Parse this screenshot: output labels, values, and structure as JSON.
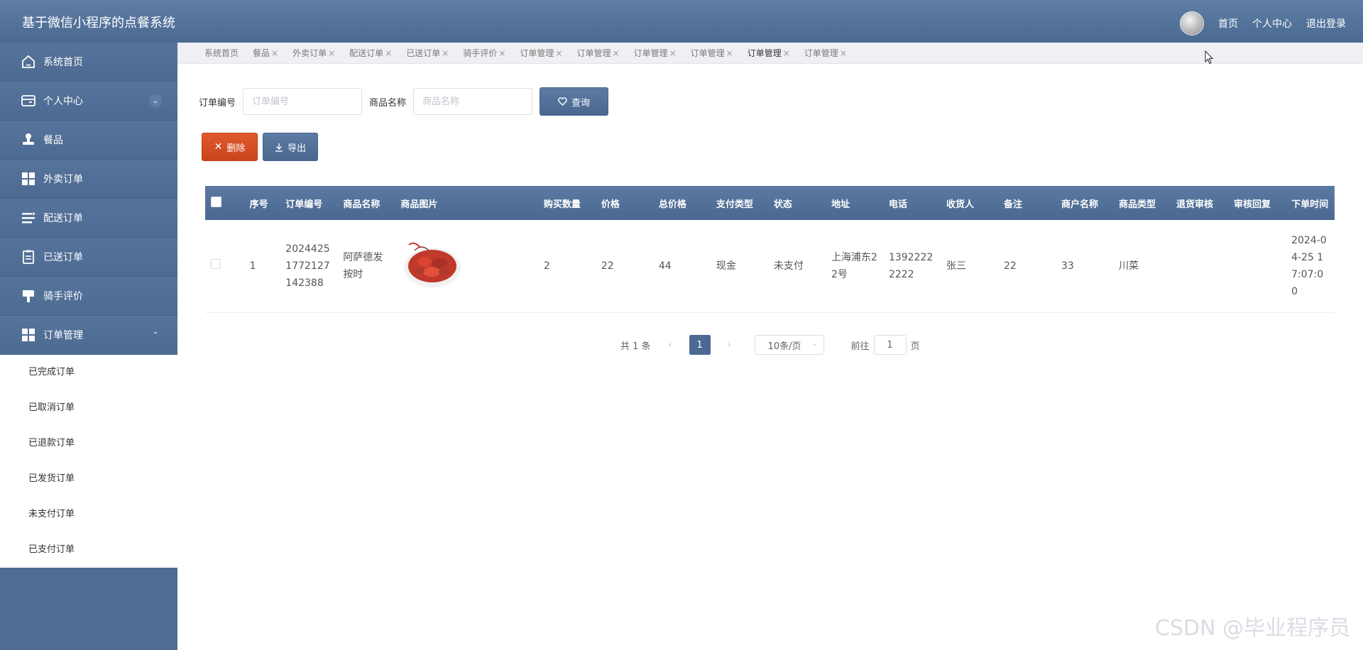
{
  "app": {
    "title": "基于微信小程序的点餐系统"
  },
  "topnav": {
    "home": "首页",
    "profile": "个人中心",
    "logout": "退出登录"
  },
  "sidebar": {
    "items": [
      {
        "label": "系统首页",
        "icon": "home-icon"
      },
      {
        "label": "个人中心",
        "icon": "card-icon",
        "expanded": false
      },
      {
        "label": "餐品",
        "icon": "stamp-icon"
      },
      {
        "label": "外卖订单",
        "icon": "grid-icon"
      },
      {
        "label": "配送订单",
        "icon": "list-icon"
      },
      {
        "label": "已送订单",
        "icon": "clipboard-icon"
      },
      {
        "label": "骑手评价",
        "icon": "brush-icon"
      },
      {
        "label": "订单管理",
        "icon": "grid-icon",
        "expanded": true
      }
    ],
    "submenu": [
      "已完成订单",
      "已取消订单",
      "已退款订单",
      "已发货订单",
      "未支付订单",
      "已支付订单"
    ]
  },
  "tabs": [
    {
      "label": "系统首页",
      "closable": false
    },
    {
      "label": "餐品",
      "closable": true
    },
    {
      "label": "外卖订单",
      "closable": true
    },
    {
      "label": "配送订单",
      "closable": true
    },
    {
      "label": "已送订单",
      "closable": true
    },
    {
      "label": "骑手评价",
      "closable": true
    },
    {
      "label": "订单管理",
      "closable": true
    },
    {
      "label": "订单管理",
      "closable": true
    },
    {
      "label": "订单管理",
      "closable": true
    },
    {
      "label": "订单管理",
      "closable": true
    },
    {
      "label": "订单管理",
      "closable": true,
      "active": true
    },
    {
      "label": "订单管理",
      "closable": true
    }
  ],
  "filters": {
    "order_no_label": "订单编号",
    "order_no_placeholder": "订单编号",
    "product_label": "商品名称",
    "product_placeholder": "商品名称",
    "search_label": "查询"
  },
  "actions": {
    "delete_label": "删除",
    "export_label": "导出"
  },
  "table": {
    "columns": [
      "序号",
      "订单编号",
      "商品名称",
      "商品图片",
      "购买数量",
      "价格",
      "总价格",
      "支付类型",
      "状态",
      "地址",
      "电话",
      "收货人",
      "备注",
      "商户名称",
      "商品类型",
      "退货审核",
      "审核回复",
      "下单时间"
    ],
    "rows": [
      {
        "index": "1",
        "order_no": "20244251772127142388",
        "product_name": "阿萨德发按时",
        "image": "crayfish-image",
        "quantity": "2",
        "price": "22",
        "total": "44",
        "pay_type": "现金",
        "status": "未支付",
        "address": "上海浦东22号",
        "phone": "13922222222",
        "receiver": "张三",
        "note": "22",
        "merchant": "33",
        "product_type": "川菜",
        "return_review": "",
        "review_reply": "",
        "order_time": "2024-04-25 17:07:00"
      }
    ]
  },
  "pagination": {
    "total_text": "共 1 条",
    "current_page": "1",
    "page_size": "10条/页",
    "goto_label": "前往",
    "goto_value": "1",
    "page_suffix": "页"
  },
  "watermark": "CSDN @毕业程序员",
  "colors": {
    "primary": "#4c6a91",
    "danger": "#d14c22",
    "header_bg": "#5b7aa2"
  }
}
